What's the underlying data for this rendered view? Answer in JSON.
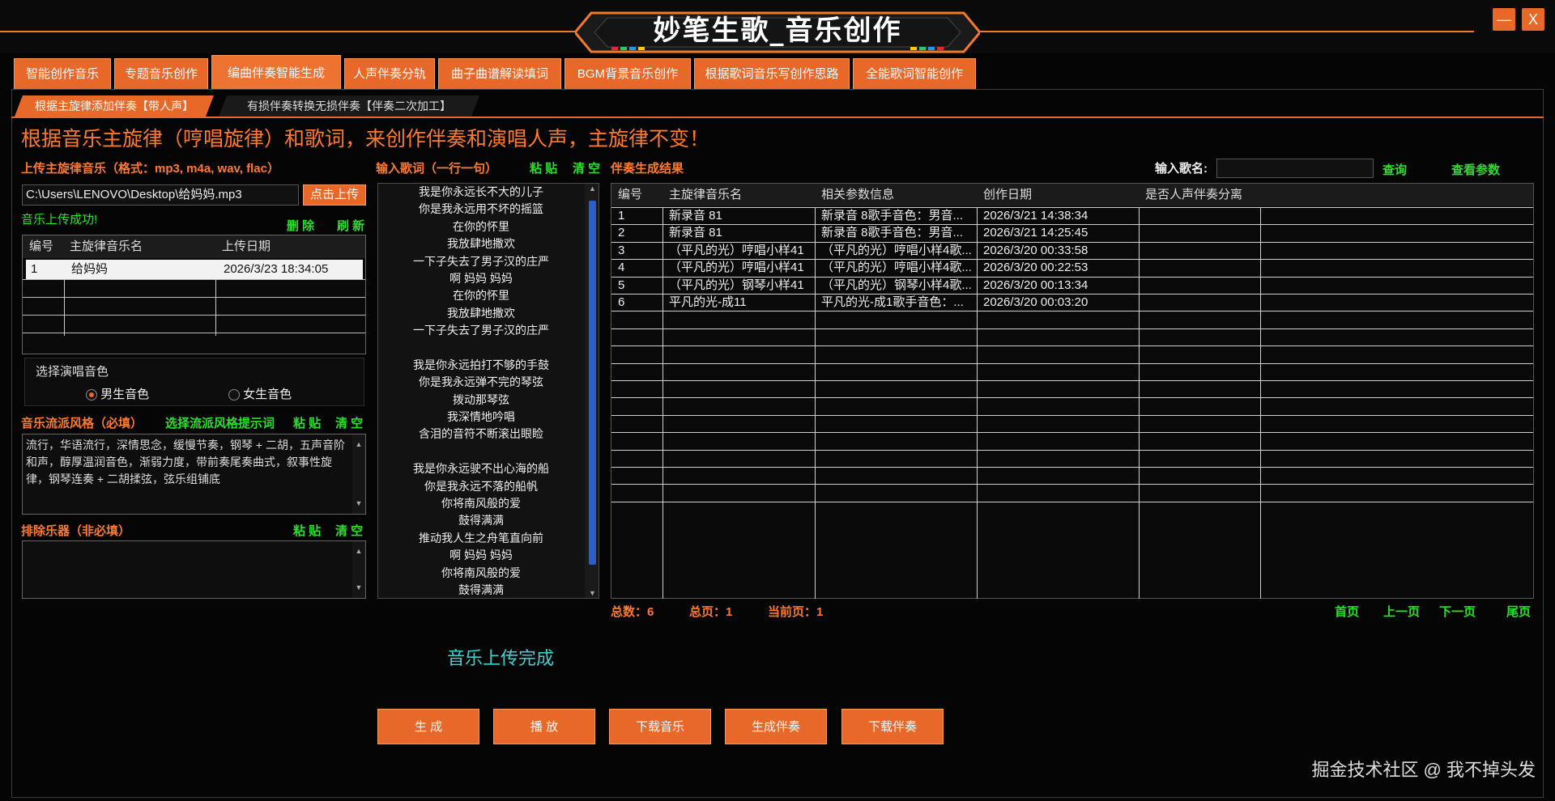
{
  "app": {
    "title": "妙笔生歌_音乐创作",
    "minimize_label": "—",
    "close_label": "X"
  },
  "main_tabs": [
    {
      "label": "智能创作音乐",
      "active": false
    },
    {
      "label": "专题音乐创作",
      "active": false
    },
    {
      "label": "编曲伴奏智能生成",
      "active": true
    },
    {
      "label": "人声伴奏分轨",
      "active": false
    },
    {
      "label": "曲子曲谱解读填词",
      "active": false
    },
    {
      "label": "BGM背景音乐创作",
      "active": false
    },
    {
      "label": "根据歌词音乐写创作思路",
      "active": false
    },
    {
      "label": "全能歌词智能创作",
      "active": false
    }
  ],
  "sub_tabs": [
    {
      "label": "根据主旋律添加伴奏【带人声】",
      "active": true
    },
    {
      "label": "有损伴奏转换无损伴奏【伴奏二次加工】",
      "active": false
    }
  ],
  "headline": "根据音乐主旋律（哼唱旋律）和歌词，来创作伴奏和演唱人声，主旋律不变！",
  "upload": {
    "label": "上传主旋律音乐（格式：mp3, m4a, wav, flac）",
    "path_value": "C:\\Users\\LENOVO\\Desktop\\给妈妈.mp3",
    "upload_button": "点击上传",
    "success_msg": "音乐上传成功!",
    "delete_label": "删 除",
    "refresh_label": "刷 新",
    "table": {
      "headers": [
        "编号",
        "主旋律音乐名",
        "上传日期"
      ],
      "rows": [
        [
          "1",
          "给妈妈",
          "2026/3/23 18:34:05"
        ]
      ]
    }
  },
  "voice": {
    "group_label": "选择演唱音色",
    "male_label": "男生音色",
    "female_label": "女生音色",
    "selected": "male"
  },
  "style": {
    "label": "音乐流派风格（必填）",
    "hint_link": "选择流派风格提示词",
    "paste_label": "粘 贴",
    "clear_label": "清 空",
    "value": "流行，华语流行，深情思念，缓慢节奏，钢琴 + 二胡，五声音阶和声，醇厚温润音色，渐弱力度，带前奏尾奏曲式，叙事性旋律，钢琴连奏 + 二胡揉弦，弦乐组铺底"
  },
  "exclude": {
    "label": "排除乐器（非必填）",
    "paste_label": "粘 贴",
    "clear_label": "清 空",
    "value": ""
  },
  "lyrics": {
    "label": "输入歌词（一行一句）",
    "paste_label": "粘 贴",
    "clear_label": "清 空",
    "lines": [
      "我是你永远长不大的儿子",
      "你是我永远用不坏的摇篮",
      "在你的怀里",
      "我放肆地撒欢",
      "一下子失去了男子汉的庄严",
      "啊 妈妈 妈妈",
      "在你的怀里",
      "我放肆地撒欢",
      "一下子失去了男子汉的庄严",
      "",
      "我是你永远拍打不够的手鼓",
      "你是我永远弹不完的琴弦",
      "拨动那琴弦",
      "我深情地吟唱",
      "含泪的音符不断滚出眼睑",
      "",
      "我是你永远驶不出心海的船",
      "你是我永远不落的船帆",
      "你将南风般的爱",
      "鼓得满满",
      "推动我人生之舟笔直向前",
      "啊 妈妈 妈妈",
      "你将南风般的爱",
      "鼓得满满"
    ]
  },
  "results": {
    "label": "伴奏生成结果",
    "song_name_label": "输入歌名:",
    "song_name_value": "",
    "query_label": "查询",
    "view_params_label": "查看参数",
    "headers": [
      "编号",
      "主旋律音乐名",
      "相关参数信息",
      "创作日期",
      "是否人声伴奏分离"
    ],
    "rows": [
      [
        "1",
        "新录音 81",
        "新录音 8歌手音色：男音...",
        "2026/3/21 14:38:34",
        ""
      ],
      [
        "2",
        "新录音 81",
        "新录音 8歌手音色：男音...",
        "2026/3/21 14:25:45",
        ""
      ],
      [
        "3",
        "（平凡的光）哼唱小样41",
        "（平凡的光）哼唱小样4歌...",
        "2026/3/20 00:33:58",
        ""
      ],
      [
        "4",
        "（平凡的光）哼唱小样41",
        "（平凡的光）哼唱小样4歌...",
        "2026/3/20 00:22:53",
        ""
      ],
      [
        "5",
        "（平凡的光）钢琴小样41",
        "（平凡的光）钢琴小样4歌...",
        "2026/3/20 00:13:34",
        ""
      ],
      [
        "6",
        "平凡的光-成11",
        "平凡的光-成1歌手音色：...",
        "2026/3/20 00:03:20",
        ""
      ]
    ],
    "pager": {
      "total": "总数：6",
      "pages": "总页：1",
      "current": "当前页：1",
      "first": "首页",
      "prev": "上一页",
      "next": "下一页",
      "last": "尾页"
    }
  },
  "status_message": "音乐上传完成",
  "actions": [
    "生 成",
    "播 放",
    "下载音乐",
    "生成伴奏",
    "下载伴奏"
  ],
  "watermark": "掘金技术社区 @ 我不掉头发",
  "colors": {
    "accent": "#e8682a",
    "label_orange": "#ff7a2e",
    "label_green": "#28e028",
    "status_cyan": "#3fd0d0",
    "background": "#050505"
  }
}
